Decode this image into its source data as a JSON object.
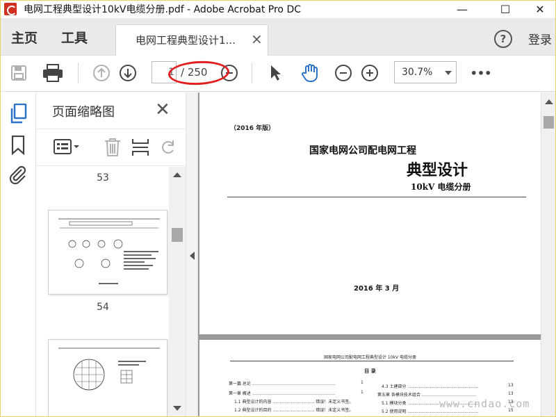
{
  "window": {
    "title": "电网工程典型设计10kV电缆分册.pdf - Adobe Acrobat Pro DC",
    "minimize": "—",
    "maximize": "☐",
    "close": "✕"
  },
  "tabs": {
    "home": "主页",
    "tools": "工具",
    "document": "电网工程典型设计1...",
    "document_close": "×",
    "help": "?",
    "login": "登录"
  },
  "toolbar": {
    "page_current": "1",
    "page_total": "/ 250",
    "zoom": "30.7%",
    "more": "•••"
  },
  "thumbnail_panel": {
    "title": "页面缩略图",
    "close": "✕",
    "page_labels": [
      "53",
      "54"
    ]
  },
  "document": {
    "page1": {
      "edition": "（2016 年版）",
      "organization": "国家电网公司配电网工程",
      "title": "典型设计",
      "subtitle": "10kV 电缆分册",
      "date": "2016 年 3 月"
    },
    "page2": {
      "header": "国家电网公司配电网工程典型设计   10kV 电缆分册",
      "toc_title": "目   录",
      "toc_left": [
        {
          "text": "第一篇  总论 ……………………………………………………",
          "page": "1"
        },
        {
          "text": "第一章  概述 ……………………………………………………",
          "page": "1"
        },
        {
          "text": "1.1 典型设计的内容 ………………………… 错误！未定义书签。",
          "page": ""
        },
        {
          "text": "1.2 典型设计的目的 ………………………… 错误！未定义书签。",
          "page": ""
        }
      ],
      "toc_right": [
        {
          "text": "4.3 土建部分 ……………………………………………",
          "page": "13"
        },
        {
          "text": "第五章  各模块技术组合 …………………………………",
          "page": "13"
        },
        {
          "text": "5.1 模块分类 ……………………………………………",
          "page": "13"
        },
        {
          "text": "5.2 使用说明 ……………………………………………",
          "page": "15"
        }
      ]
    }
  },
  "watermark": "www.cndao.com",
  "colors": {
    "accent_blue": "#2a73c9",
    "annotation_red": "#e02020",
    "toolbar_grey": "#eaeaea"
  }
}
